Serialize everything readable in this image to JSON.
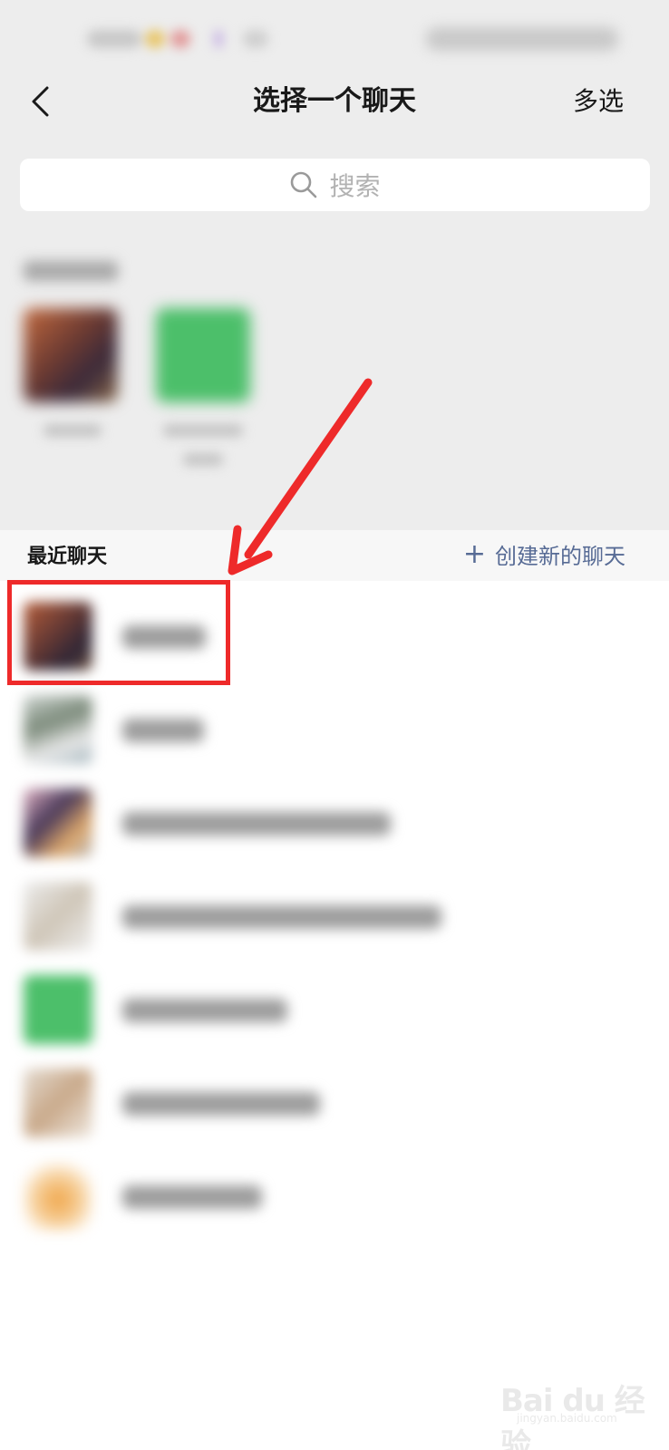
{
  "nav": {
    "title": "选择一个聊天",
    "multi_select_label": "多选",
    "back_icon": "chevron-left-icon"
  },
  "search": {
    "placeholder": "搜索",
    "icon": "search-icon"
  },
  "recent": {
    "label": "最近聊天",
    "create_label": "创建新的聊天",
    "create_icon": "plus-icon"
  },
  "watermark": {
    "text": "Bai du 经验",
    "sub": "jingyan.baidu.com"
  },
  "colors": {
    "accent_link": "#576b95",
    "annotation_red": "#ee2a2a",
    "wechat_green": "#4cbf6a"
  }
}
